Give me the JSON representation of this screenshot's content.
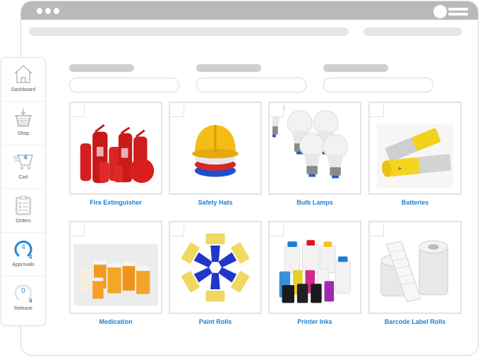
{
  "window": {
    "accent_color": "#1d80d2",
    "chrome_color": "#b9b9b9"
  },
  "sidebar": {
    "items": [
      {
        "id": "dashboard",
        "label": "Dashboard",
        "icon": "house-icon"
      },
      {
        "id": "shop",
        "label": "Shop",
        "icon": "basket-icon"
      },
      {
        "id": "cart",
        "label": "Cart",
        "icon": "cart-icon",
        "badge": "4"
      },
      {
        "id": "orders",
        "label": "Orders",
        "icon": "clipboard-icon"
      },
      {
        "id": "approvals",
        "label": "Approvals",
        "icon": "gauge-icon",
        "value": "4",
        "total": "4",
        "fraction": 1.0
      },
      {
        "id": "release",
        "label": "Release",
        "icon": "gauge-icon",
        "value": "0",
        "total": "4",
        "fraction": 0.0
      }
    ]
  },
  "products": [
    {
      "name": "Fire Extinguisher",
      "image": "fire-extinguisher-image"
    },
    {
      "name": "Safety Hats",
      "image": "safety-hats-image"
    },
    {
      "name": "Bulb Lamps",
      "image": "bulb-lamps-image"
    },
    {
      "name": "Batteries",
      "image": "batteries-image"
    },
    {
      "name": "Medication",
      "image": "medication-image"
    },
    {
      "name": "Paint Rolls",
      "image": "paint-rolls-image"
    },
    {
      "name": "Printer Inks",
      "image": "printer-inks-image"
    },
    {
      "name": "Barcode Label Rolls",
      "image": "barcode-label-rolls-image"
    }
  ]
}
